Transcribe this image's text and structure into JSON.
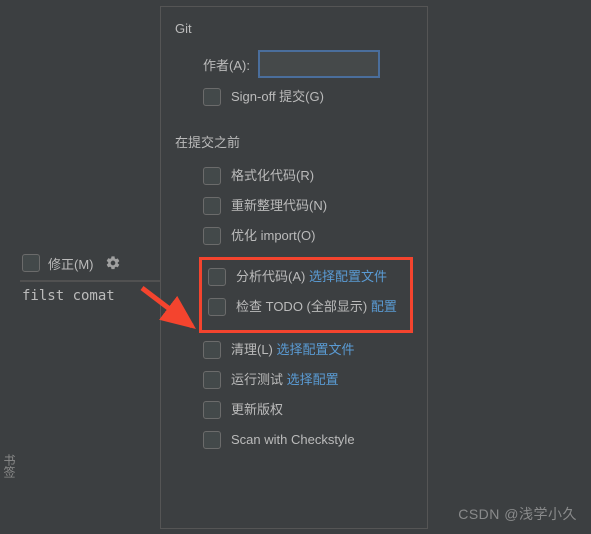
{
  "left": {
    "amend_label": "修正(M)",
    "row2_text": "filst comat"
  },
  "popup": {
    "git_header": "Git",
    "author_label": "作者(A):",
    "author_value": "",
    "signoff_label": "Sign-off 提交(G)",
    "before_commit_header": "在提交之前",
    "opts": {
      "format_code": "格式化代码(R)",
      "rearrange_code": "重新整理代码(N)",
      "optimize_imports": "优化 import(O)",
      "analyze_code": "分析代码(A)",
      "analyze_code_link": "选择配置文件",
      "check_todo": "检查 TODO (全部显示)",
      "check_todo_link": "配置",
      "cleanup": "清理(L)",
      "cleanup_link": "选择配置文件",
      "run_tests": "运行测试",
      "run_tests_link": "选择配置",
      "update_copyright": "更新版权",
      "scan_checkstyle": "Scan with Checkstyle"
    }
  },
  "vertical_tab": "书签",
  "watermark": "CSDN @浅学小久"
}
